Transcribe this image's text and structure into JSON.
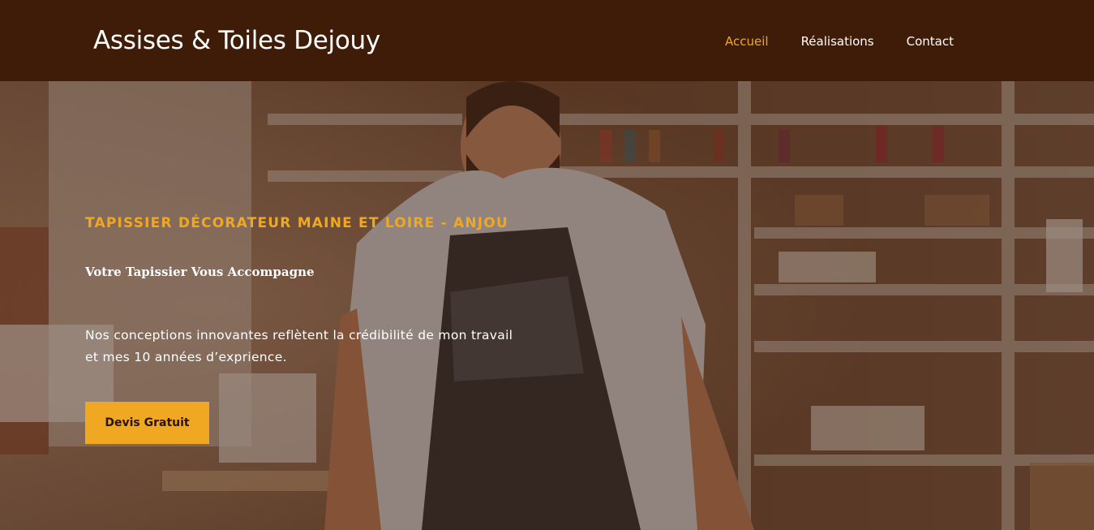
{
  "header": {
    "site_title": "Assises & Toiles Dejouy",
    "nav": [
      {
        "label": "Accueil",
        "active": true
      },
      {
        "label": "Réalisations",
        "active": false
      },
      {
        "label": "Contact",
        "active": false
      }
    ]
  },
  "hero": {
    "kicker": "TAPISSIER DÉCORATEUR MAINE ET LOIRE - ANJOU",
    "subtitle": "Votre Tapissier Vous Accompagne",
    "description": "Nos conceptions innovantes reflètent la crédibilité de mon travail et mes 10 années d’exprience.",
    "cta_label": "Devis Gratuit",
    "background_image": "upholsterer-workshop-photo"
  },
  "colors": {
    "header_bg": "#3e1c07",
    "accent": "#f0a823",
    "text": "#ffffff"
  }
}
